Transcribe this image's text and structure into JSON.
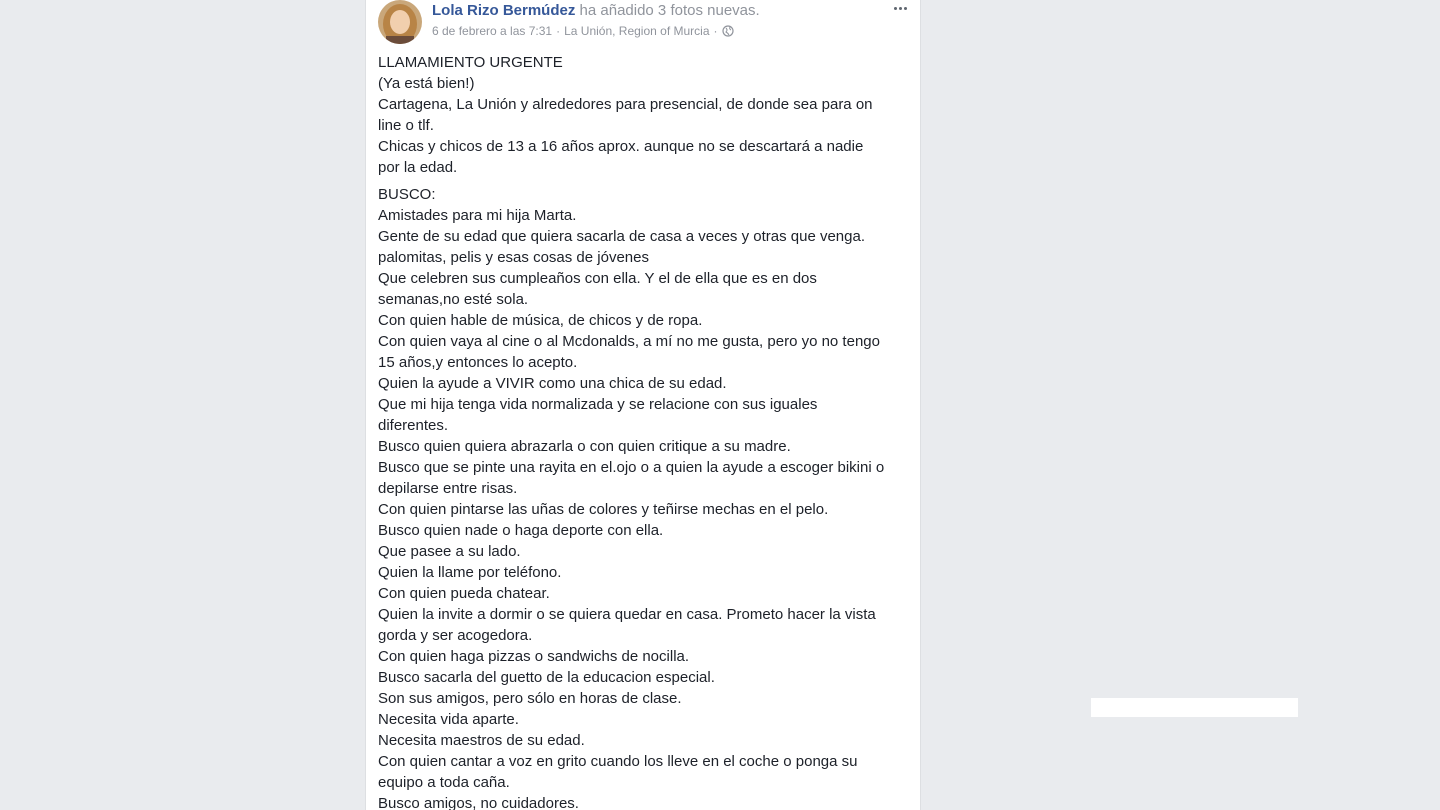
{
  "post": {
    "author": "Lola Rizo Bermúdez",
    "action": " ha añadido 3 fotos nuevas.",
    "timestamp": "6 de febrero a las 7:31",
    "separator": " · ",
    "location": "La Unión, Region of Murcia",
    "icons": {
      "privacy": "globe-icon",
      "menu": "more-options-icon"
    },
    "paragraphs": [
      "LLAMAMIENTO URGENTE\n(Ya está bien!)\nCartagena, La Unión y alrededores para presencial, de donde sea para on\nline o tlf.\nChicas y chicos de 13 a 16 años aprox. aunque no se descartará a nadie\npor la edad.",
      "BUSCO:\nAmistades para mi hija Marta.\nGente de su edad que quiera sacarla de casa a veces y otras que venga.\npalomitas, pelis y esas cosas de jóvenes\nQue celebren sus cumpleaños con ella. Y el de ella que es en dos\nsemanas,no esté sola.\nCon quien hable de música, de chicos y de ropa.\nCon quien vaya al cine o al Mcdonalds, a mí no me gusta, pero yo no tengo\n15 años,y entonces lo acepto.\nQuien la ayude a VIVIR como una chica de su edad.\nQue mi hija tenga vida normalizada y se relacione con sus iguales\ndiferentes.\nBusco quien quiera abrazarla o con quien critique a su madre.\nBusco que se pinte una rayita en el.ojo o a quien la ayude a escoger bikini o\ndepilarse entre risas.\nCon quien pintarse las uñas de colores y teñirse mechas en el pelo.\nBusco quien nade o haga deporte con ella.\nQue pasee a su lado.\nQuien la llame por teléfono.\nCon quien pueda chatear.\nQuien la invite a dormir o se quiera quedar en casa. Prometo hacer la vista\ngorda y ser acogedora.\nCon quien haga pizzas o sandwichs de nocilla.\nBusco sacarla del guetto de la educacion especial.\nSon sus amigos, pero sólo en horas de clase.\nNecesita vida aparte.\nNecesita maestros de su edad.\nCon quien cantar a voz en grito cuando los lleve en el coche o ponga su\nequipo a toda caña.\nBusco amigos, no cuidadores."
    ]
  },
  "colors": {
    "background": "#e9ebee",
    "card": "#ffffff",
    "link": "#365899",
    "meta": "#90949c",
    "text": "#1d2129"
  }
}
